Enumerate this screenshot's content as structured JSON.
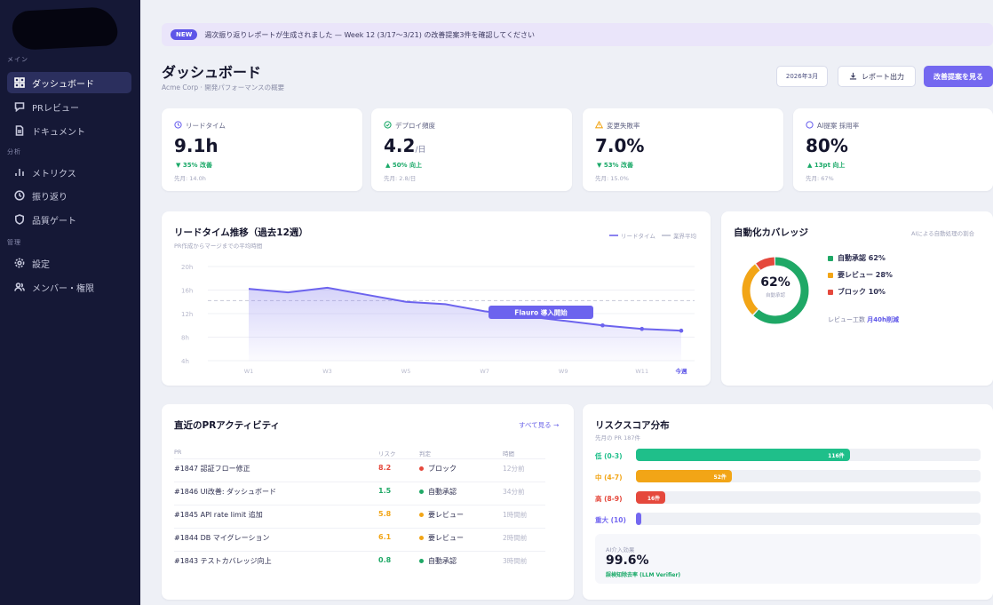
{
  "colors": {
    "accent": "#7468f0",
    "sidebar": "#151836",
    "good": "#1aa968",
    "warn": "#f2a516",
    "bad": "#e5483c"
  },
  "sidebar": {
    "sections": {
      "main": "メイン",
      "analysis": "分析",
      "manage": "管理"
    },
    "items": [
      {
        "label": "ダッシュボード",
        "icon": "grid-icon",
        "active": true
      },
      {
        "label": "PRレビュー",
        "icon": "comment-icon"
      },
      {
        "label": "ドキュメント",
        "icon": "document-icon"
      },
      {
        "label": "メトリクス",
        "icon": "bar-chart-icon"
      },
      {
        "label": "振り返り",
        "icon": "clock-icon"
      },
      {
        "label": "品質ゲート",
        "icon": "shield-icon"
      },
      {
        "label": "設定",
        "icon": "gear-icon"
      },
      {
        "label": "メンバー・権限",
        "icon": "users-icon"
      }
    ]
  },
  "banner": {
    "badge": "NEW",
    "text": "週次振り返りレポートが生成されました — Week 12 (3/17〜3/21) の改善提案3件を確認してください"
  },
  "header": {
    "title": "ダッシュボード",
    "subtitle": "Acme Corp · 開発パフォーマンスの概要",
    "period": "2026年3月",
    "export_label": "レポート出力",
    "primary_label": "改善提案を見る"
  },
  "kpis": [
    {
      "label": "リードタイム",
      "icon": "clock-icon",
      "value": "9.1h",
      "unit": "",
      "trend": "▼ 35% 改善",
      "prev": "先月: 14.0h"
    },
    {
      "label": "デプロイ頻度",
      "icon": "check-circle-icon",
      "value": "4.2",
      "unit": "/日",
      "trend": "▲ 50% 向上",
      "prev": "先月: 2.8/日"
    },
    {
      "label": "変更失敗率",
      "icon": "warning-icon",
      "value": "7.0%",
      "unit": "",
      "trend": "▼ 53% 改善",
      "prev": "先月: 15.0%"
    },
    {
      "label": "AI提案 採用率",
      "icon": "circle-icon",
      "value": "80%",
      "unit": "",
      "trend": "▲ 13pt 向上",
      "prev": "先月: 67%"
    }
  ],
  "leadtime": {
    "title": "リードタイム推移（過去12週）",
    "subtitle": "PR作成からマージまでの平均時間",
    "legend_a": "リードタイム",
    "legend_b": "業界平均",
    "annotation": "Flauro 導入開始"
  },
  "chart_data": {
    "type": "line",
    "x": [
      "W1",
      "W2",
      "W3",
      "W4",
      "W5",
      "W6",
      "W7",
      "W8",
      "W9",
      "W10",
      "W11",
      "今週"
    ],
    "x_tick_labels": [
      "W1",
      "W3",
      "W5",
      "W7",
      "W9",
      "W11",
      "今週"
    ],
    "y_tick_labels": [
      "20h",
      "16h",
      "12h",
      "8h",
      "4h"
    ],
    "ylim": [
      4,
      20
    ],
    "series": [
      {
        "name": "リードタイム",
        "values": [
          16.2,
          15.6,
          16.4,
          15.2,
          14.0,
          13.6,
          12.4,
          11.6,
          10.8,
          10.0,
          9.4,
          9.1
        ]
      },
      {
        "name": "業界平均",
        "values": [
          14.2,
          14.2,
          14.2,
          14.2,
          14.2,
          14.2,
          14.2,
          14.2,
          14.2,
          14.2,
          14.2,
          14.2
        ]
      }
    ],
    "grid": true
  },
  "coverage": {
    "title": "自動化カバレッジ",
    "note": "AIによる自動処理の割合",
    "center_value": "62%",
    "center_label": "自動承認",
    "segments": [
      {
        "label": "自動承認",
        "value": 62,
        "text": "自動承認 62%",
        "color": "#1fa866"
      },
      {
        "label": "要レビュー",
        "value": 28,
        "text": "要レビュー 28%",
        "color": "#f2a516"
      },
      {
        "label": "ブロック",
        "value": 10,
        "text": "ブロック 10%",
        "color": "#e5483c"
      }
    ],
    "saving_prefix": "レビュー工数",
    "saving_value": "月40h削減"
  },
  "pr_activity": {
    "title": "直近のPRアクティビティ",
    "see_all": "すべて見る →",
    "headers": [
      "PR",
      "リスク",
      "判定",
      "時間"
    ],
    "rows": [
      {
        "pr": "#1847 認証フロー修正",
        "risk": "8.2",
        "risk_color": "#e5483c",
        "status": "ブロック",
        "status_color": "#e5483c",
        "time": "12分前"
      },
      {
        "pr": "#1846 UI改善: ダッシュボード",
        "risk": "1.5",
        "risk_color": "#1fa866",
        "status": "自動承認",
        "status_color": "#1fa866",
        "time": "34分前"
      },
      {
        "pr": "#1845 API rate limit 追加",
        "risk": "5.8",
        "risk_color": "#f2a516",
        "status": "要レビュー",
        "status_color": "#f2a516",
        "time": "1時間前"
      },
      {
        "pr": "#1844 DB マイグレーション",
        "risk": "6.1",
        "risk_color": "#f2a516",
        "status": "要レビュー",
        "status_color": "#f2a516",
        "time": "2時間前"
      },
      {
        "pr": "#1843 テストカバレッジ向上",
        "risk": "0.8",
        "risk_color": "#1fa866",
        "status": "自動承認",
        "status_color": "#1fa866",
        "time": "3時間前"
      }
    ]
  },
  "risk_dist": {
    "title": "リスクスコア分布",
    "subtitle": "先月の PR 187件",
    "bars": [
      {
        "label": "低 (0-3)",
        "value": 116,
        "text": "116件",
        "color": "#1fbf8a"
      },
      {
        "label": "中 (4-7)",
        "value": 52,
        "text": "52件",
        "color": "#f2a516"
      },
      {
        "label": "高 (8-9)",
        "value": 16,
        "text": "16件",
        "color": "#e5483c"
      },
      {
        "label": "重大 (10)",
        "value": 3,
        "text": "",
        "color": "#7468f0"
      }
    ],
    "max": 187,
    "ai_label": "AI介入効果",
    "ai_value": "99.6%",
    "ai_note": "誤検知除去率 (LLM Verifier)"
  }
}
